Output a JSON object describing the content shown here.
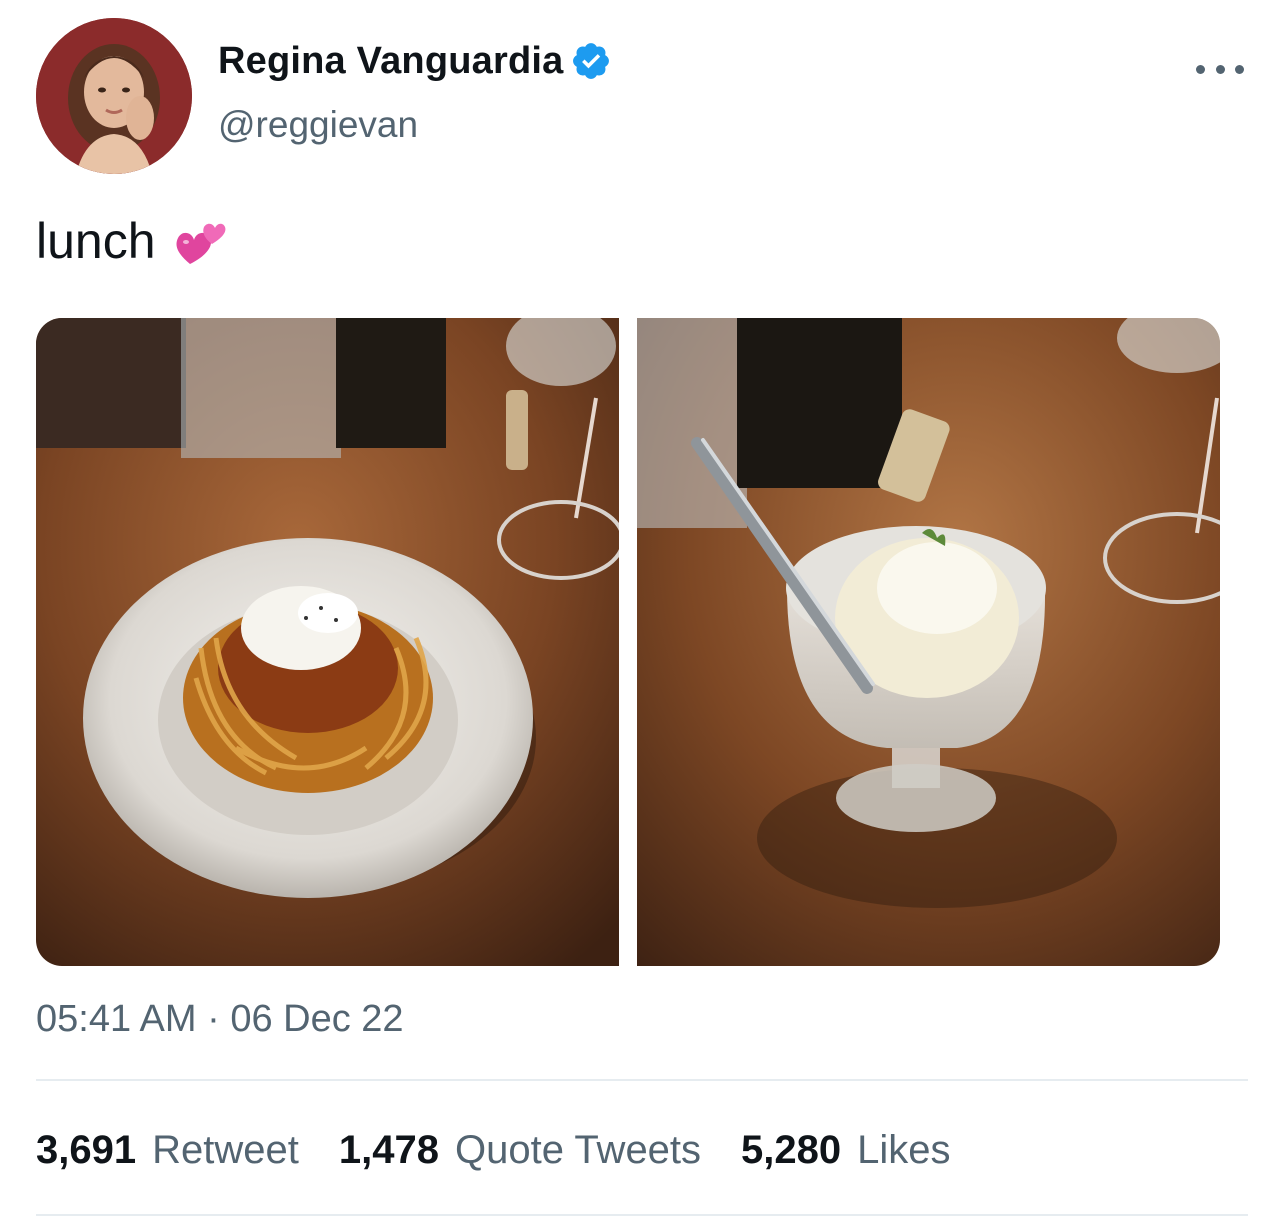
{
  "user": {
    "display_name": "Regina Vanguardia",
    "handle": "@reggievan",
    "verified": true,
    "avatar_icon": "profile-photo"
  },
  "tweet": {
    "text": "lunch",
    "emoji": "💕",
    "timestamp": "05:41 AM · 06 Dec 22"
  },
  "media": [
    {
      "icon": "photo-pasta-bowl"
    },
    {
      "icon": "photo-ice-cream-cup"
    }
  ],
  "stats": {
    "retweets_count": "3,691",
    "retweets_label": "Retweet",
    "quotes_count": "1,478",
    "quotes_label": "Quote Tweets",
    "likes_count": "5,280",
    "likes_label": "Likes"
  },
  "colors": {
    "verified_badge": "#1d9bf0",
    "secondary_text": "#536471",
    "primary_text": "#0f1419",
    "divider": "#e6ecf0"
  }
}
